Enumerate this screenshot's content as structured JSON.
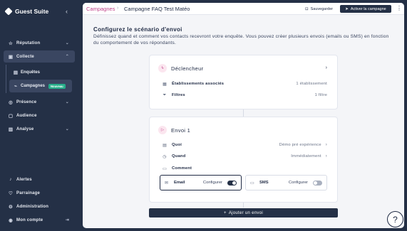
{
  "brand": {
    "name": "Guest Suite"
  },
  "sidebar": {
    "collapse_icon": "chevron-left-icon",
    "items": [
      {
        "label": "Réputation",
        "icon": "star-icon"
      },
      {
        "label": "Collecte",
        "icon": "inbox-icon"
      },
      {
        "label": "Enquêtes",
        "icon": "survey-icon"
      },
      {
        "label": "Campagnes",
        "icon": "campaign-icon",
        "badge": "Nouveau"
      },
      {
        "label": "Présence",
        "icon": "location-icon"
      },
      {
        "label": "Audience",
        "icon": "audience-icon"
      },
      {
        "label": "Analyse",
        "icon": "chart-icon"
      },
      {
        "label": "Alertes",
        "icon": "bell-icon"
      },
      {
        "label": "Parrainage",
        "icon": "referral-icon"
      },
      {
        "label": "Administration",
        "icon": "gear-icon"
      },
      {
        "label": "Mon compte",
        "icon": "user-icon"
      }
    ]
  },
  "header": {
    "breadcrumb_root": "Campagnes",
    "breadcrumb_current": "Campagne FAQ Test Matéo",
    "save_label": "Sauvegarder",
    "activate_label": "Activer la campagne"
  },
  "main": {
    "title": "Configurez le scénario d'envoi",
    "description": "Définissez quand et comment vos contacts recevront votre enquête. Vous pouvez créer plusieurs envois (emails ou SMS) en fonction du comportement de vos répondants."
  },
  "trigger": {
    "title": "Déclencheur",
    "rows": [
      {
        "label": "Établissements associés",
        "value": "1 établissement"
      },
      {
        "label": "Filtres",
        "value": "1 filtre"
      }
    ]
  },
  "send": {
    "title": "Envoi 1",
    "rows": [
      {
        "label": "Quoi",
        "value": "Démo pré expérience"
      },
      {
        "label": "Quand",
        "value": "Immédiatement"
      },
      {
        "label": "Comment",
        "value": ""
      }
    ],
    "channels": [
      {
        "name": "Email",
        "config_label": "Configurer",
        "enabled": true
      },
      {
        "name": "SMS",
        "config_label": "Configurer",
        "enabled": false
      }
    ]
  },
  "add_send_label": "Ajouter un envoi",
  "help_label": "?",
  "colors": {
    "sidebar": "#243046",
    "accent": "#c0428a",
    "badge": "#27ae8a"
  }
}
